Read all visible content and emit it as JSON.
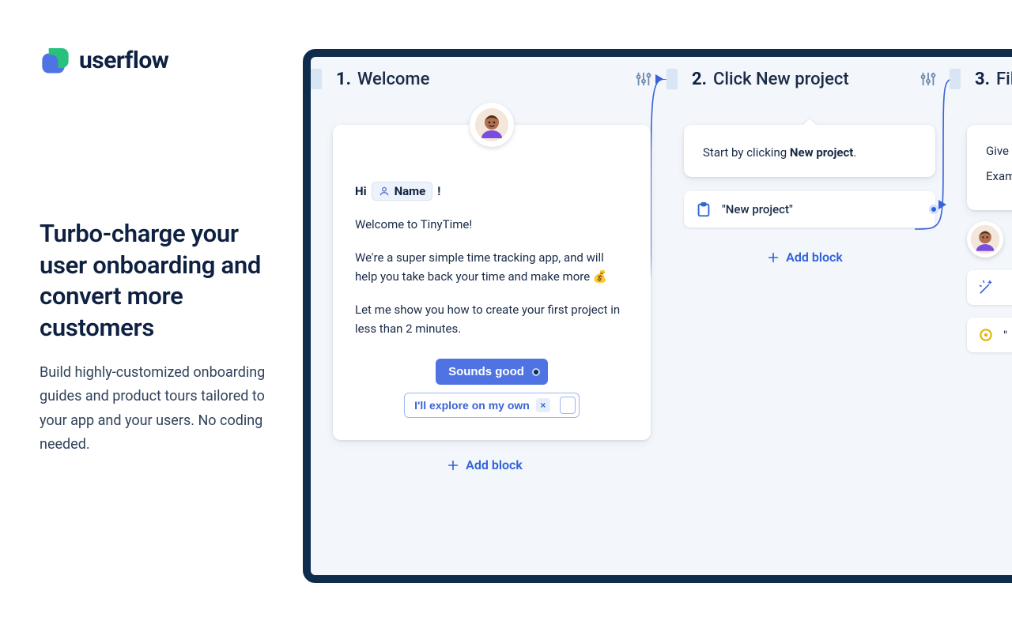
{
  "brand": {
    "name": "userflow"
  },
  "hero": {
    "title": "Turbo-charge your user onboarding and convert more customers",
    "subtitle": "Build highly-customized onboarding guides and product tours tailored to your app and your users. No coding needed."
  },
  "editor": {
    "add_block_label": "Add block",
    "steps": [
      {
        "num": "1.",
        "title": "Welcome",
        "greeting_prefix": "Hi",
        "greeting_chip": "Name",
        "greeting_suffix": "!",
        "para1": "Welcome to TinyTime!",
        "para2": "We're a super simple time tracking app, and will help you take back your time and make more 💰",
        "para3": "Let me show you how to create your first project in less than 2 minutes.",
        "primary_btn": "Sounds good",
        "secondary_btn": "I'll explore on my own"
      },
      {
        "num": "2.",
        "title": "Click New project",
        "tip_prefix": "Start by clicking ",
        "tip_bold": "New project",
        "tip_suffix": ".",
        "target_label": "\"New project\""
      },
      {
        "num": "3.",
        "title": "Fill",
        "line1": "Give",
        "line2": "Exam"
      }
    ]
  }
}
